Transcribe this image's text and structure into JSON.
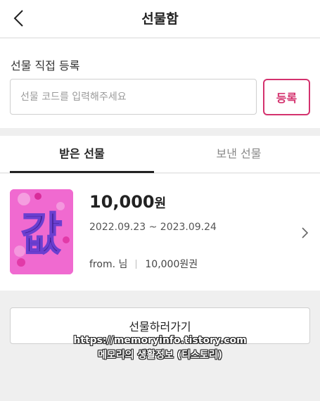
{
  "header": {
    "title": "선물함",
    "back_icon": "chevron-left-icon"
  },
  "register": {
    "title": "선물 직접 등록",
    "input_placeholder": "선물 코드를 입력해주세요",
    "input_value": "",
    "button_label": "등록",
    "accent_color": "#d4326e"
  },
  "tabs": [
    {
      "label": "받은 선물",
      "active": true
    },
    {
      "label": "보낸 선물",
      "active": false
    }
  ],
  "gift": {
    "image_text": "값",
    "amount": "10,000",
    "amount_unit": "원",
    "period": "2022.09.23 ~ 2023.09.24",
    "from": "from. 님",
    "voucher": "10,000원권",
    "chevron_icon": "chevron-right-icon",
    "thumb_color": "#f06ad0"
  },
  "action": {
    "button_label": "선물하러가기"
  },
  "watermark": {
    "url": "https://memoryinfo.tistory.com",
    "name": "메모리의 생활정보 (티스토리)"
  }
}
